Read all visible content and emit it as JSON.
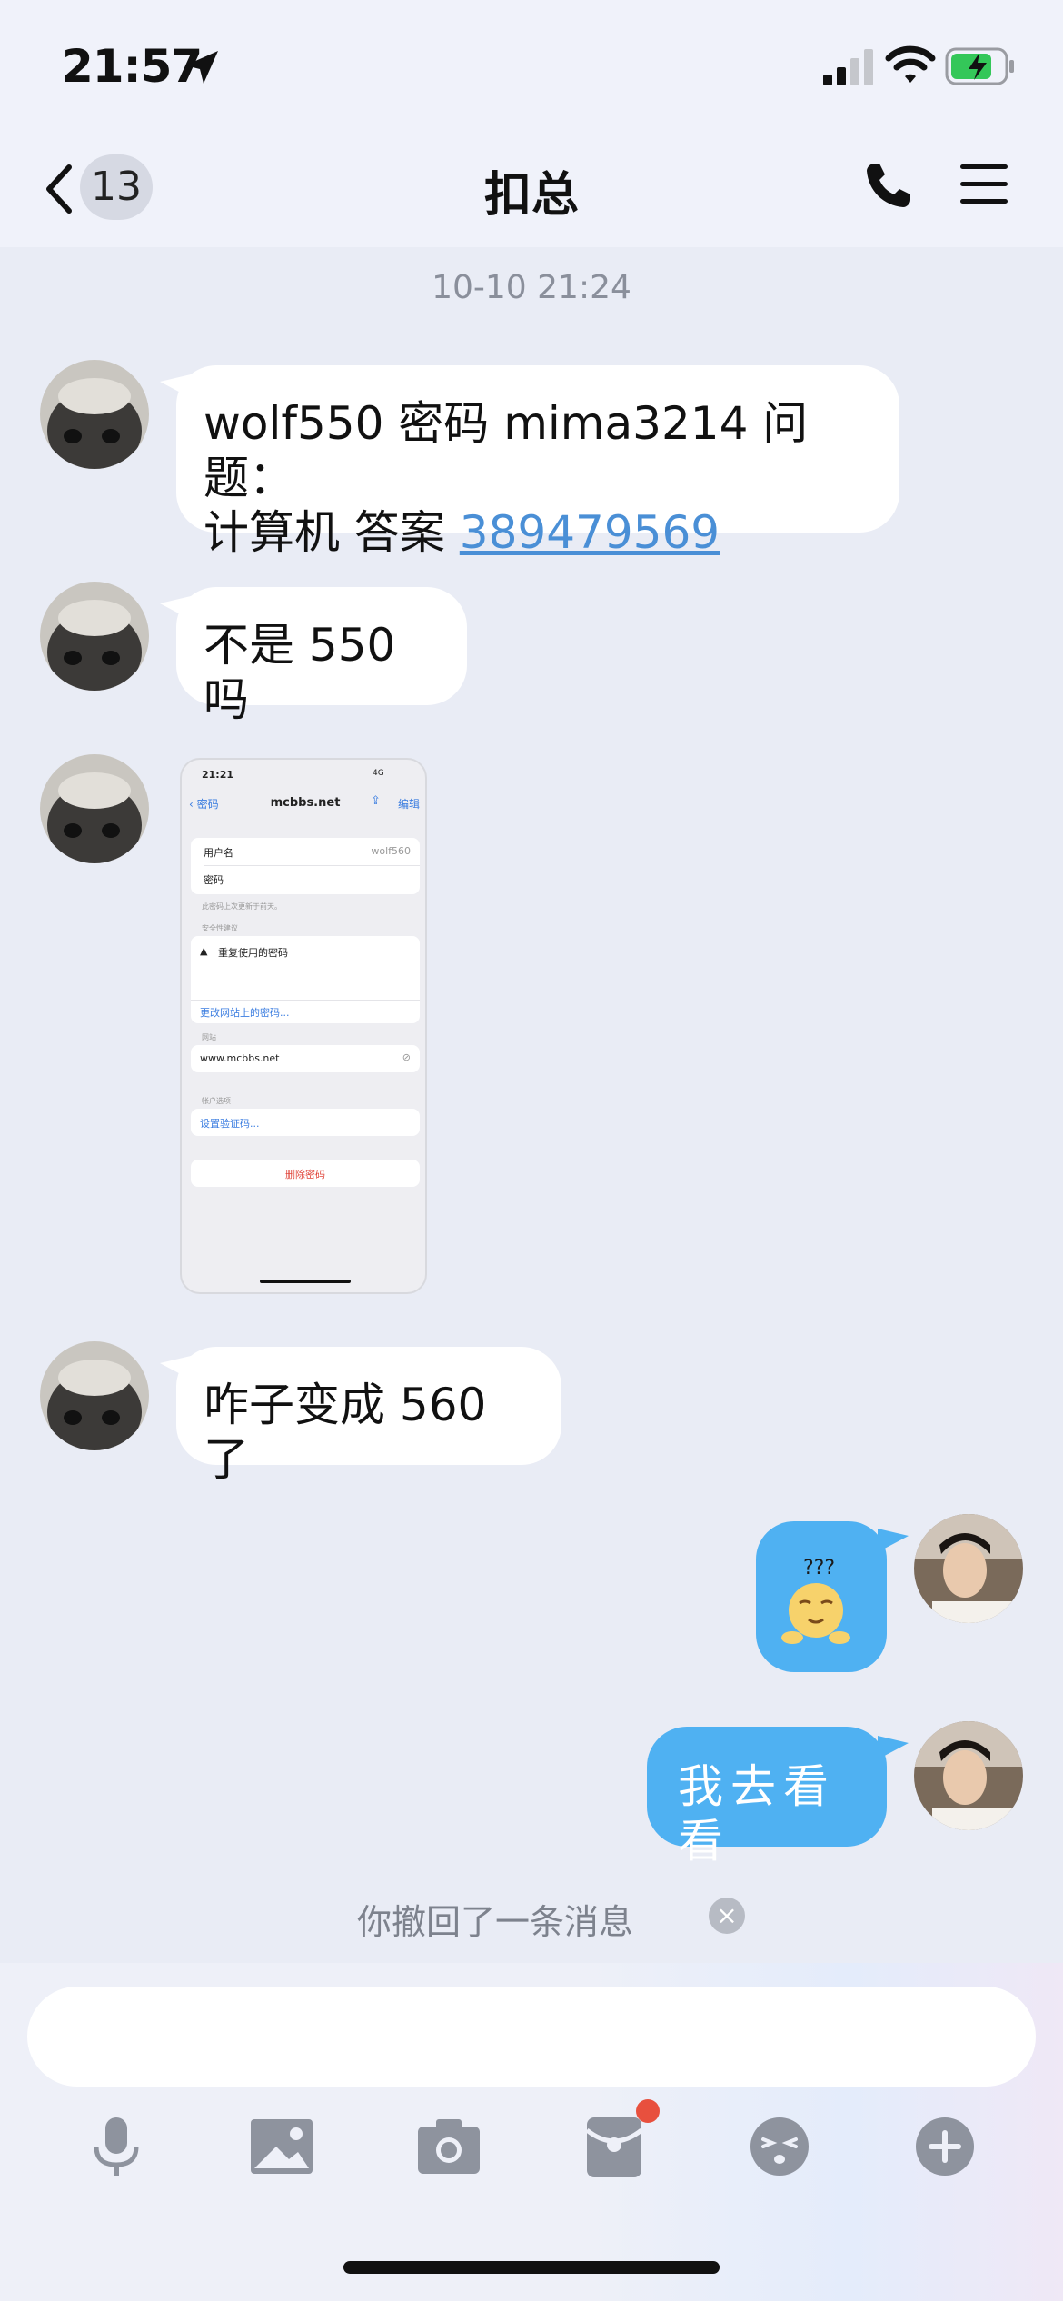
{
  "status_bar": {
    "time": "21:57",
    "battery_color": "#34c759"
  },
  "header": {
    "back_count": "13",
    "title": "扣总"
  },
  "timestamp": "10-10 21:24",
  "messages": [
    {
      "side": "in",
      "line1": "wolf550 密码 mima3214  问题：",
      "line2_prefix": "计算机  答案 ",
      "line2_link": "389479569"
    },
    {
      "side": "in",
      "text": "不是 550 吗"
    },
    {
      "side": "in",
      "type": "image"
    },
    {
      "side": "in",
      "text": "咋子变成 560 了"
    },
    {
      "side": "out",
      "type": "sticker",
      "sticker_text": "???"
    },
    {
      "side": "out",
      "text": "我去看看"
    }
  ],
  "screenshot": {
    "time": "21:21",
    "signal": "4G",
    "back_label": "密码",
    "title": "mcbbs.net",
    "edit_label": "编辑",
    "username_label": "用户名",
    "username_value": "wolf560",
    "password_label": "密码",
    "updated_note": "此密码上次更新于前天。",
    "security_header": "安全性建议",
    "security_warning": "重复使用的密码",
    "change_link": "更改网站上的密码...",
    "website_header": "网站",
    "website_value": "www.mcbbs.net",
    "account_header": "帐户选项",
    "setup_code": "设置验证码...",
    "delete": "删除密码"
  },
  "recall_text": "你撤回了一条消息",
  "toolbar": {
    "icons": [
      "microphone-icon",
      "image-icon",
      "camera-icon",
      "red-packet-icon",
      "emoji-icon",
      "plus-icon"
    ],
    "icon_color": "#8e939e",
    "accent_red": "#e8503e"
  },
  "colors": {
    "outgoing_bubble": "#4fb1f2",
    "link": "#4a8fd6",
    "background": "#e9ecf5"
  }
}
